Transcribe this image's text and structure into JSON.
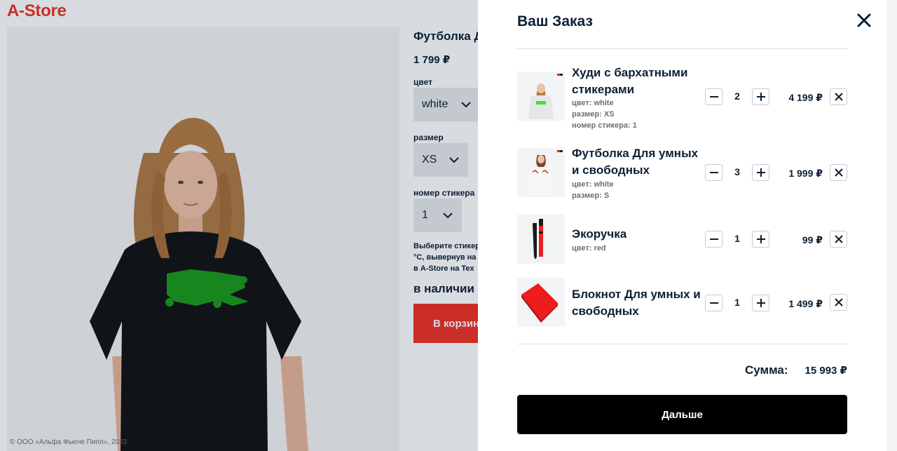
{
  "header": {
    "logo": "A-Store"
  },
  "product": {
    "title": "Футболка Для умных и свободных",
    "price": "1 799 ₽",
    "color_label": "цвет",
    "color_value": "white",
    "size_label": "размер",
    "size_value": "XS",
    "sticker_label": "номер стикера",
    "sticker_value": "1",
    "hint_lines": [
      "Выберите стикер",
      "°C, вывернув на",
      "в A-Store на Tex"
    ],
    "stock": "в наличии",
    "add_to_cart": "В корзину"
  },
  "footer": {
    "copyright": "© ООО «Альфа Фьюче Пипл», 2023"
  },
  "cart": {
    "title": "Ваш Заказ",
    "items": [
      {
        "name": "Худи с бархатными стикерами",
        "props": [
          "цвет: white",
          "размер: XS",
          "номер стикера: 1"
        ],
        "qty": "2",
        "price": "4 199 ₽",
        "icon": "hoodie-photo"
      },
      {
        "name": "Футболка Для умных и свободных",
        "props": [
          "цвет: white",
          "размер: S"
        ],
        "qty": "3",
        "price": "1 999 ₽",
        "icon": "tshirt-photo"
      },
      {
        "name": "Экоручка",
        "props": [
          "цвет: red"
        ],
        "qty": "1",
        "price": "99 ₽",
        "icon": "pen-photo"
      },
      {
        "name": "Блокнот Для умных и свободных",
        "props": [],
        "qty": "1",
        "price": "1 499 ₽",
        "icon": "notebook-photo"
      }
    ],
    "sum_label": "Сумма:",
    "sum_value": "15 993 ₽",
    "next_label": "Дальше"
  },
  "colors": {
    "brand_red": "#ef3124",
    "text_dark": "#0b1f35",
    "muted": "#6a6f75",
    "sticker_green": "#1b9a1b"
  }
}
